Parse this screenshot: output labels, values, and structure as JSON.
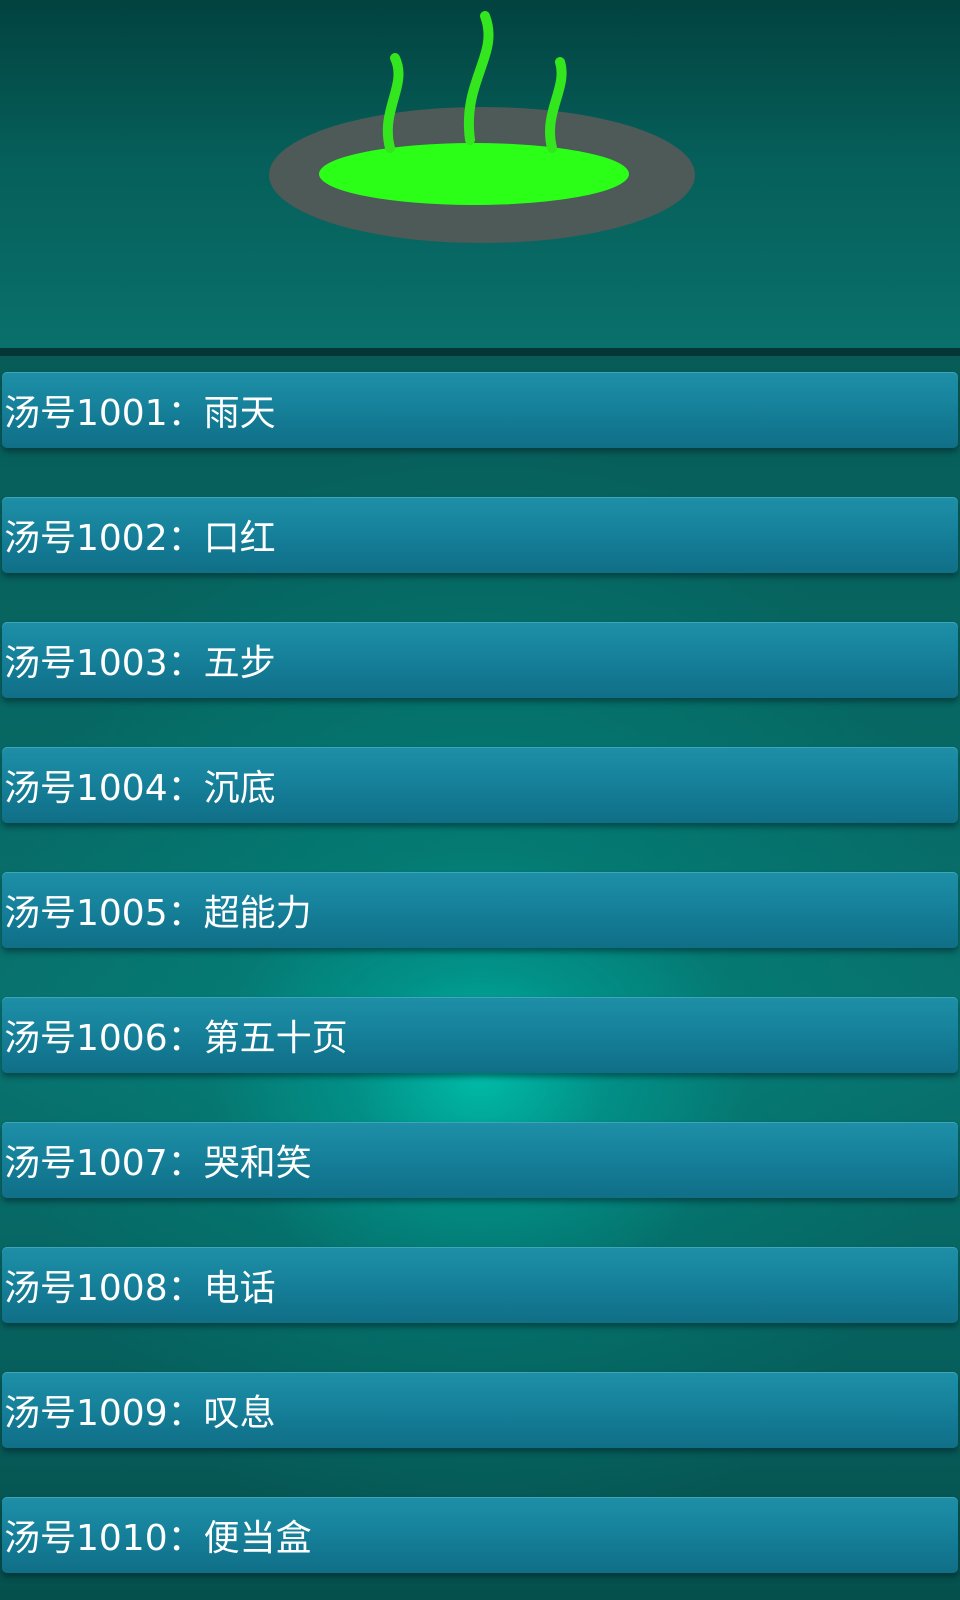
{
  "header": {
    "icon": "steaming-soup-bowl-icon",
    "colors": {
      "soup": "#2bff18",
      "steam": "#33e61e",
      "bowl_rim": "#4d5a58"
    }
  },
  "list": {
    "items": [
      {
        "label": "汤号1001：雨天"
      },
      {
        "label": "汤号1002：口红"
      },
      {
        "label": "汤号1003：五步"
      },
      {
        "label": "汤号1004：沉底"
      },
      {
        "label": "汤号1005：超能力"
      },
      {
        "label": "汤号1006：第五十页"
      },
      {
        "label": "汤号1007：哭和笑"
      },
      {
        "label": "汤号1008：电话"
      },
      {
        "label": "汤号1009：叹息"
      },
      {
        "label": "汤号1010：便当盒"
      }
    ]
  },
  "colors": {
    "item_background": "#17839c",
    "item_text": "#ffffff",
    "page_background": "#076762"
  }
}
